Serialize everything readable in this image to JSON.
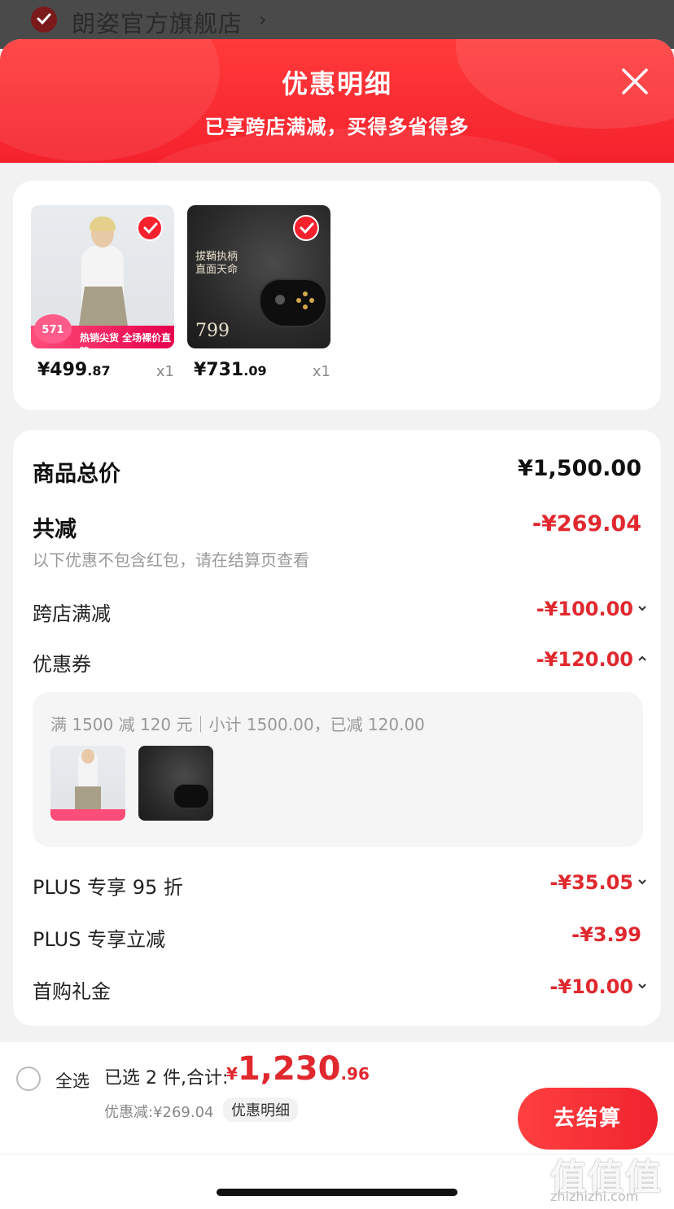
{
  "store": {
    "name": "朗姿官方旗舰店",
    "chevron": "›"
  },
  "sheet": {
    "title": "优惠明细",
    "subtitle": "已享跨店满减，买得多省得多"
  },
  "products": [
    {
      "price_main": "¥499",
      "price_dec": ".87",
      "qty": "x1",
      "promo_badge": "571",
      "promo_text": "热销尖货 全场裸价直降"
    },
    {
      "price_main": "¥731",
      "price_dec": ".09",
      "qty": "x1",
      "ad_text_1": "拔鞘执柄",
      "ad_text_2": "直面天命",
      "ad_price": "799"
    }
  ],
  "details": {
    "total_label": "商品总价",
    "total_value": "¥1,500.00",
    "reduce_label": "共减",
    "reduce_value": "-¥269.04",
    "reduce_note": "以下优惠不包含红包，请在结算页查看",
    "items": [
      {
        "label": "跨店满减",
        "value": "-¥100.00"
      },
      {
        "label": "优惠券",
        "value": "-¥120.00"
      },
      {
        "label": "PLUS 专享 95 折",
        "value": "-¥35.05"
      },
      {
        "label": "PLUS 专享立减",
        "value": "-¥3.99"
      },
      {
        "label": "首购礼金",
        "value": "-¥10.00"
      }
    ],
    "coupon_detail": "满 1500 减 120 元｜小计 1500.00，已减 120.00"
  },
  "bottom": {
    "select_all": "全选",
    "selected_label": "已选 2 件,合计:",
    "currency": "¥",
    "total_int": "1,230",
    "total_dec": ".96",
    "discount_line": "优惠减:¥269.04",
    "detail_pill": "优惠明细",
    "checkout": "去结算"
  },
  "watermark": {
    "text": "值值值",
    "sub": "zhizhizhi.com"
  },
  "colors": {
    "accent": "#f5222d",
    "price_red": "#e0282e"
  }
}
